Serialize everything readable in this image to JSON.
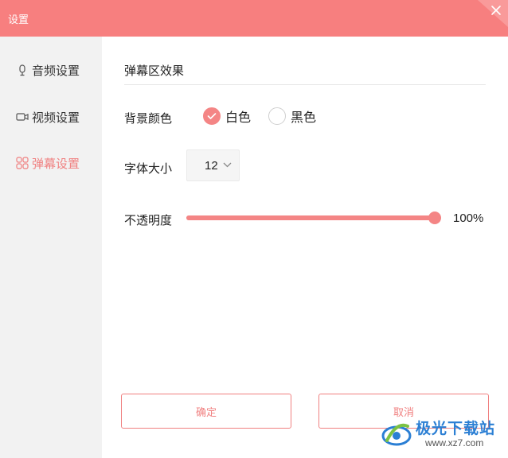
{
  "window": {
    "title": "设置"
  },
  "sidebar": {
    "items": [
      {
        "label": "音频设置",
        "icon": "microphone-icon",
        "active": false
      },
      {
        "label": "视频设置",
        "icon": "camera-icon",
        "active": false
      },
      {
        "label": "弹幕设置",
        "icon": "grid-icon",
        "active": true
      }
    ]
  },
  "main": {
    "section_title": "弹幕区效果",
    "background_color": {
      "label": "背景颜色",
      "options": [
        {
          "label": "白色",
          "checked": true
        },
        {
          "label": "黑色",
          "checked": false
        }
      ]
    },
    "font_size": {
      "label": "字体大小",
      "value": "12"
    },
    "opacity": {
      "label": "不透明度",
      "value": 100,
      "display": "100%"
    },
    "buttons": {
      "ok": "确定",
      "cancel": "取消"
    }
  },
  "watermark": {
    "name": "极光下载站",
    "url": "www.xz7.com"
  },
  "colors": {
    "accent": "#f48585",
    "titlebar": "#f77f7f",
    "sidebar_bg": "#f2f2f2"
  }
}
